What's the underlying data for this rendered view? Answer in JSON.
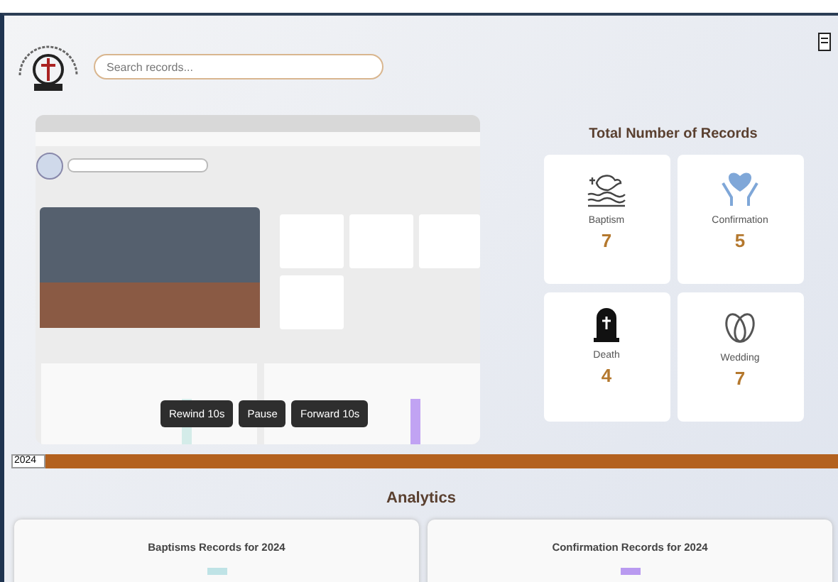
{
  "header": {
    "search": {
      "placeholder": "Search records..."
    }
  },
  "video": {
    "controls": [
      "Rewind 10s",
      "Pause",
      "Forward 10s"
    ]
  },
  "records": {
    "title": "Total Number of Records",
    "cards": [
      {
        "kind": "baptism",
        "label": "Baptism",
        "count": "7"
      },
      {
        "kind": "confirmation",
        "label": "Confirmation",
        "count": "5"
      },
      {
        "kind": "death",
        "label": "Death",
        "count": "4"
      },
      {
        "kind": "wedding",
        "label": "Wedding",
        "count": "7"
      }
    ]
  },
  "year_select": {
    "value": "2024"
  },
  "analytics": {
    "title": "Analytics",
    "charts": [
      {
        "title": "Baptisms Records for 2024",
        "color": "#bfe3e6"
      },
      {
        "title": "Confirmation Records for 2024",
        "color": "#b99af0"
      }
    ]
  }
}
